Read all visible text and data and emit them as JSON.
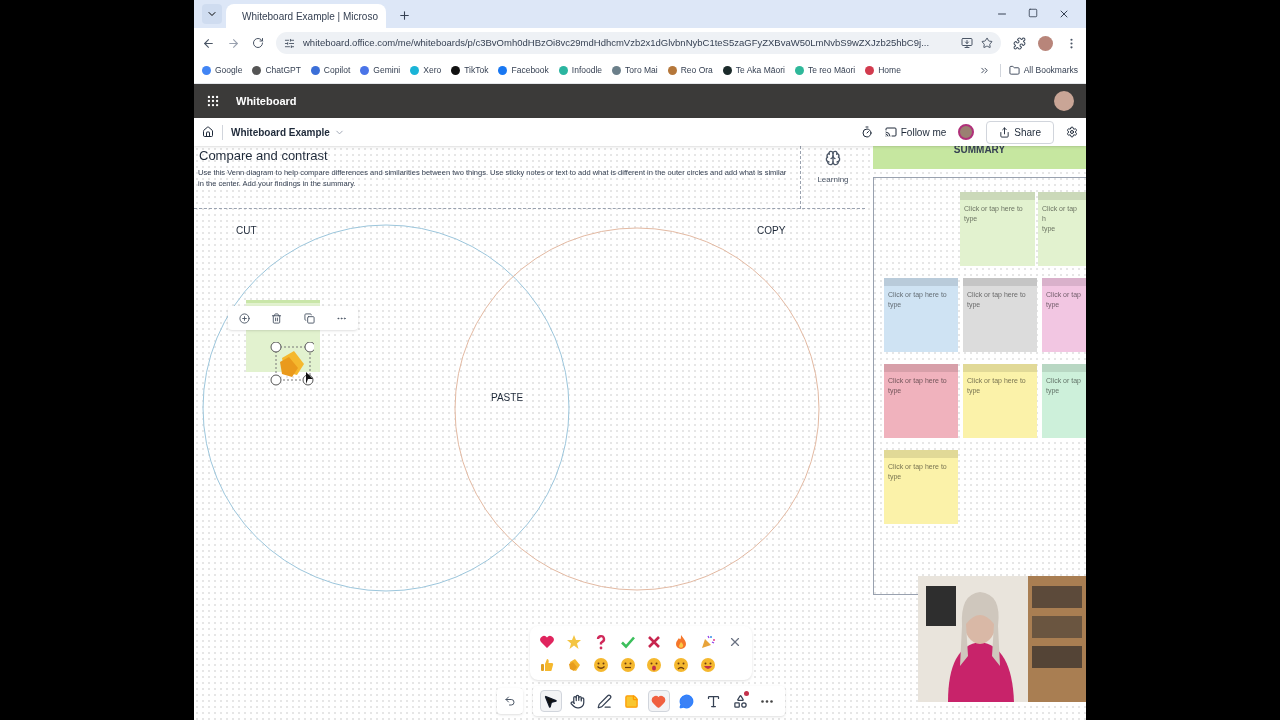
{
  "browser": {
    "tabs": [
      {
        "title": "Whiteboard Example | Microso",
        "selected": true
      }
    ],
    "url": "whiteboard.office.com/me/whiteboards/p/c3BvOmh0dHBzOi8vc29mdHdhcmVzb2x1dGlvbnNybC1teS5zaGFyZXBvaW50LmNvbS9wZXJzb25hbC9j...",
    "bookmarks": [
      {
        "label": "Google",
        "color": "#4285f4"
      },
      {
        "label": "ChatGPT",
        "color": "#555555"
      },
      {
        "label": "Copilot",
        "color": "#3b6fd8"
      },
      {
        "label": "Gemini",
        "color": "#4a74e8"
      },
      {
        "label": "Xero",
        "color": "#1ab4d7"
      },
      {
        "label": "TikTok",
        "color": "#111111"
      },
      {
        "label": "Facebook",
        "color": "#1877f2"
      },
      {
        "label": "Infoodle",
        "color": "#2bb5a0"
      },
      {
        "label": "Toro Mai",
        "color": "#6b7f8a"
      },
      {
        "label": "Reo Ora",
        "color": "#b5773a"
      },
      {
        "label": "Te Aka Māori",
        "color": "#1b2a2a"
      },
      {
        "label": "Te reo Māori",
        "color": "#2fb89a"
      },
      {
        "label": "Home",
        "color": "#d23b4e"
      }
    ],
    "all_bookmarks": "All Bookmarks"
  },
  "app": {
    "title": "Whiteboard",
    "board_name": "Whiteboard Example",
    "follow": "Follow me",
    "share": "Share"
  },
  "canvas": {
    "heading": "Compare and contrast",
    "description": "Use this Venn diagram to help compare differences and similarities between two things. Use sticky notes or text to add what is different in the outer circles and add what is similar in the center. Add your findings in the summary.",
    "learning": "Learning",
    "left_label": "CUT",
    "right_label": "COPY",
    "center_label": "PASTE",
    "summary": "SUMMARY",
    "stickies": [
      {
        "text": "Click or tap here to type",
        "color": "#e2f2cf"
      },
      {
        "text": "Click or tap h\ntype",
        "color": "#e2f2cf"
      },
      {
        "text": "Click or tap here to type",
        "color": "#cfe3f3"
      },
      {
        "text": "Click or tap here to type",
        "color": "#dcdcdc"
      },
      {
        "text": "Click or tap\ntype",
        "color": "#f2c6e2"
      },
      {
        "text": "Click or tap here to type",
        "color": "#f0b2bd"
      },
      {
        "text": "Click or tap here to type",
        "color": "#fbf2a9"
      },
      {
        "text": "Click or tap\ntype",
        "color": "#cdf0da"
      },
      {
        "text": "Click or tap here to type",
        "color": "#fbf2a9"
      }
    ]
  },
  "reactions": [
    {
      "kind": "heart"
    },
    {
      "kind": "star"
    },
    {
      "kind": "question"
    },
    {
      "kind": "check"
    },
    {
      "kind": "cross"
    },
    {
      "kind": "fire"
    },
    {
      "kind": "party"
    },
    {
      "kind": "close"
    },
    {
      "kind": "thumbs"
    },
    {
      "kind": "clap"
    },
    {
      "kind": "smile"
    },
    {
      "kind": "neutral"
    },
    {
      "kind": "surprised"
    },
    {
      "kind": "sad"
    },
    {
      "kind": "laugh"
    }
  ],
  "tools": [
    {
      "kind": "select",
      "selected": true,
      "notification": false
    },
    {
      "kind": "hand",
      "selected": false,
      "notification": false
    },
    {
      "kind": "pen",
      "selected": false,
      "notification": false
    },
    {
      "kind": "note",
      "selected": false,
      "notification": false
    },
    {
      "kind": "reaction",
      "selected": true,
      "notification": false
    },
    {
      "kind": "comment",
      "selected": false,
      "notification": false
    },
    {
      "kind": "text",
      "selected": false,
      "notification": false
    },
    {
      "kind": "shapes",
      "selected": false,
      "notification": true
    },
    {
      "kind": "more",
      "selected": false,
      "notification": false
    }
  ]
}
